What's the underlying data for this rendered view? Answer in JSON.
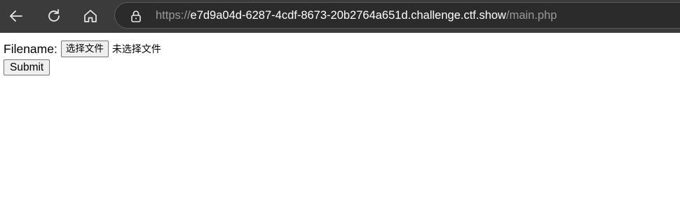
{
  "browser": {
    "url": {
      "scheme": "https://",
      "host": "e7d9a04d-6287-4cdf-8673-20b2764a651d.challenge.ctf.show",
      "path": "/main.php"
    },
    "icons": {
      "back": "arrow-left-icon",
      "reload": "reload-icon",
      "home": "home-icon",
      "lock": "lock-icon"
    },
    "colors": {
      "toolbar": "#3b3b3b",
      "address_bar": "#2b2b2b",
      "url_host": "#ffffff",
      "url_dim": "#9a9a9a"
    }
  },
  "form": {
    "filename_label": "Filename:",
    "choose_file_label": "选择文件",
    "no_file_text": "未选择文件",
    "submit_label": "Submit"
  }
}
